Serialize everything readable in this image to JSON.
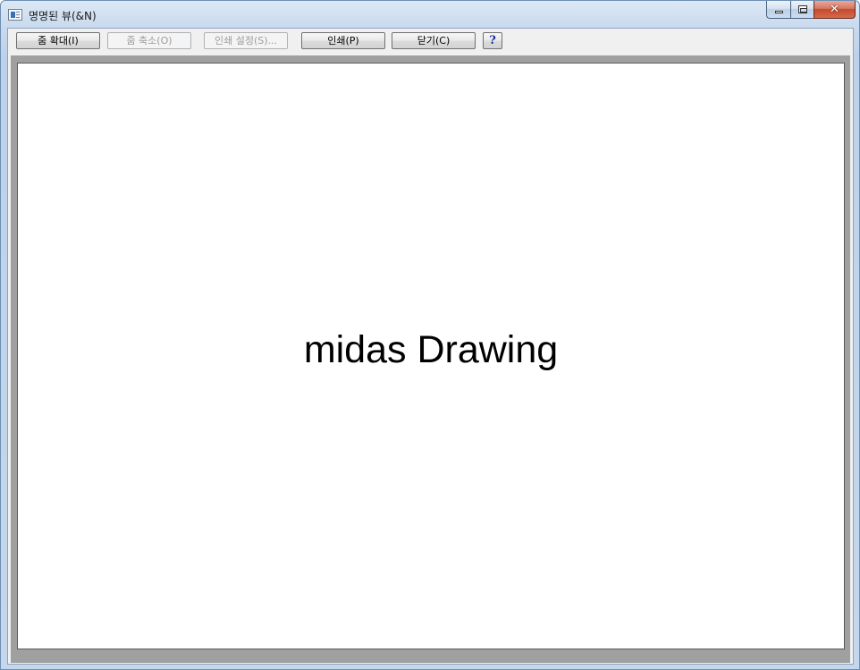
{
  "window": {
    "title": "명명된 뷰(&N)",
    "caption": {
      "close_glyph": "✕"
    }
  },
  "toolbar": {
    "zoom_in_label": "줌 확대(I)",
    "zoom_out_label": "줌 축소(O)",
    "print_setup_label": "인쇄 설정(S)...",
    "print_label": "인쇄(P)",
    "close_label": "닫기(C)",
    "help_label": "?"
  },
  "canvas": {
    "text": "midas Drawing"
  },
  "colors": {
    "canvas_background": "#ffffff",
    "frame_gray": "#a0a0a0",
    "help_icon_blue": "#1a2f9a",
    "close_button_red": "#c44a2e"
  },
  "states": {
    "zoom_out_enabled": false,
    "print_setup_enabled": false
  }
}
